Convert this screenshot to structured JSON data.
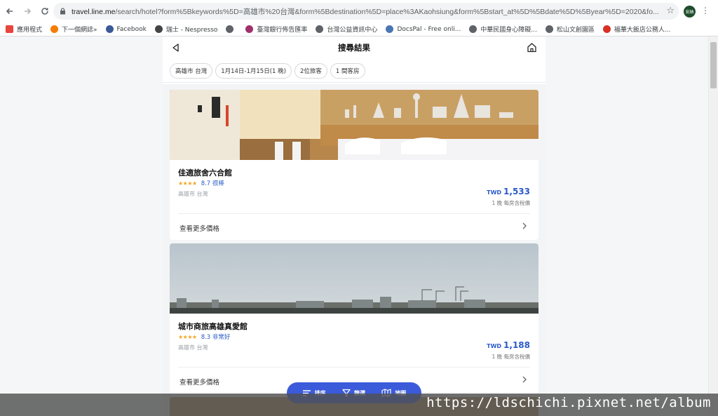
{
  "browser": {
    "url_host": "travel.line.me",
    "url_path": "/search/hotel?form%5Bkeywords%5D=高雄市%20台灣&form%5Bdestination%5D=place%3AKaohsiung&form%5Bstart_at%5D%5Bdate%5D%5Byear%5D=2020&fo...",
    "profile_label": "安納",
    "bookmarks": [
      {
        "label": "應用程式",
        "color": "#e8453c"
      },
      {
        "label": "下一個網誌»",
        "color": "#f57c00"
      },
      {
        "label": "Facebook",
        "color": "#3b5998"
      },
      {
        "label": "瑞士 - Nespresso",
        "color": "#444444"
      },
      {
        "label": "",
        "color": "#5f6368"
      },
      {
        "label": "臺灣銀行佈告匯率",
        "color": "#a0306a"
      },
      {
        "label": "台灣公益資訊中心",
        "color": "#5f6368"
      },
      {
        "label": "DocsPal - Free onli...",
        "color": "#4a77b4"
      },
      {
        "label": "中華民國身心障礙...",
        "color": "#5f6368"
      },
      {
        "label": "松山文創園區",
        "color": "#5f6368"
      },
      {
        "label": "福華大飯店公務人...",
        "color": "#d93025"
      }
    ]
  },
  "app": {
    "title": "搜尋結果",
    "chips": [
      "高雄市 台灣",
      "1月14日-1月15日(1 晚)",
      "2位旅客",
      "1 間客房"
    ]
  },
  "hotels": [
    {
      "name": "佳適旅舍六合館",
      "stars": "★★★★",
      "score": "8.7 很棒",
      "location": "高雄市 台灣",
      "currency": "TWD",
      "price": "1,533",
      "price_note": "1 晚 每房含稅價",
      "more_label": "查看更多價格"
    },
    {
      "name": "城市商旅高雄真愛館",
      "stars": "★★★★",
      "score": "8.3 非常好",
      "location": "高雄市 台灣",
      "currency": "TWD",
      "price": "1,188",
      "price_note": "1 晚 每房含稅價",
      "more_label": "查看更多價格"
    }
  ],
  "bottom_bar": {
    "sort_label": "排序",
    "filter_label": "篩選",
    "map_label": "地圖"
  },
  "watermark": "https://ldschichi.pixnet.net/album",
  "colors": {
    "accent": "#3b5bdb",
    "price": "#2a5ac8",
    "stars": "#f4a623"
  }
}
